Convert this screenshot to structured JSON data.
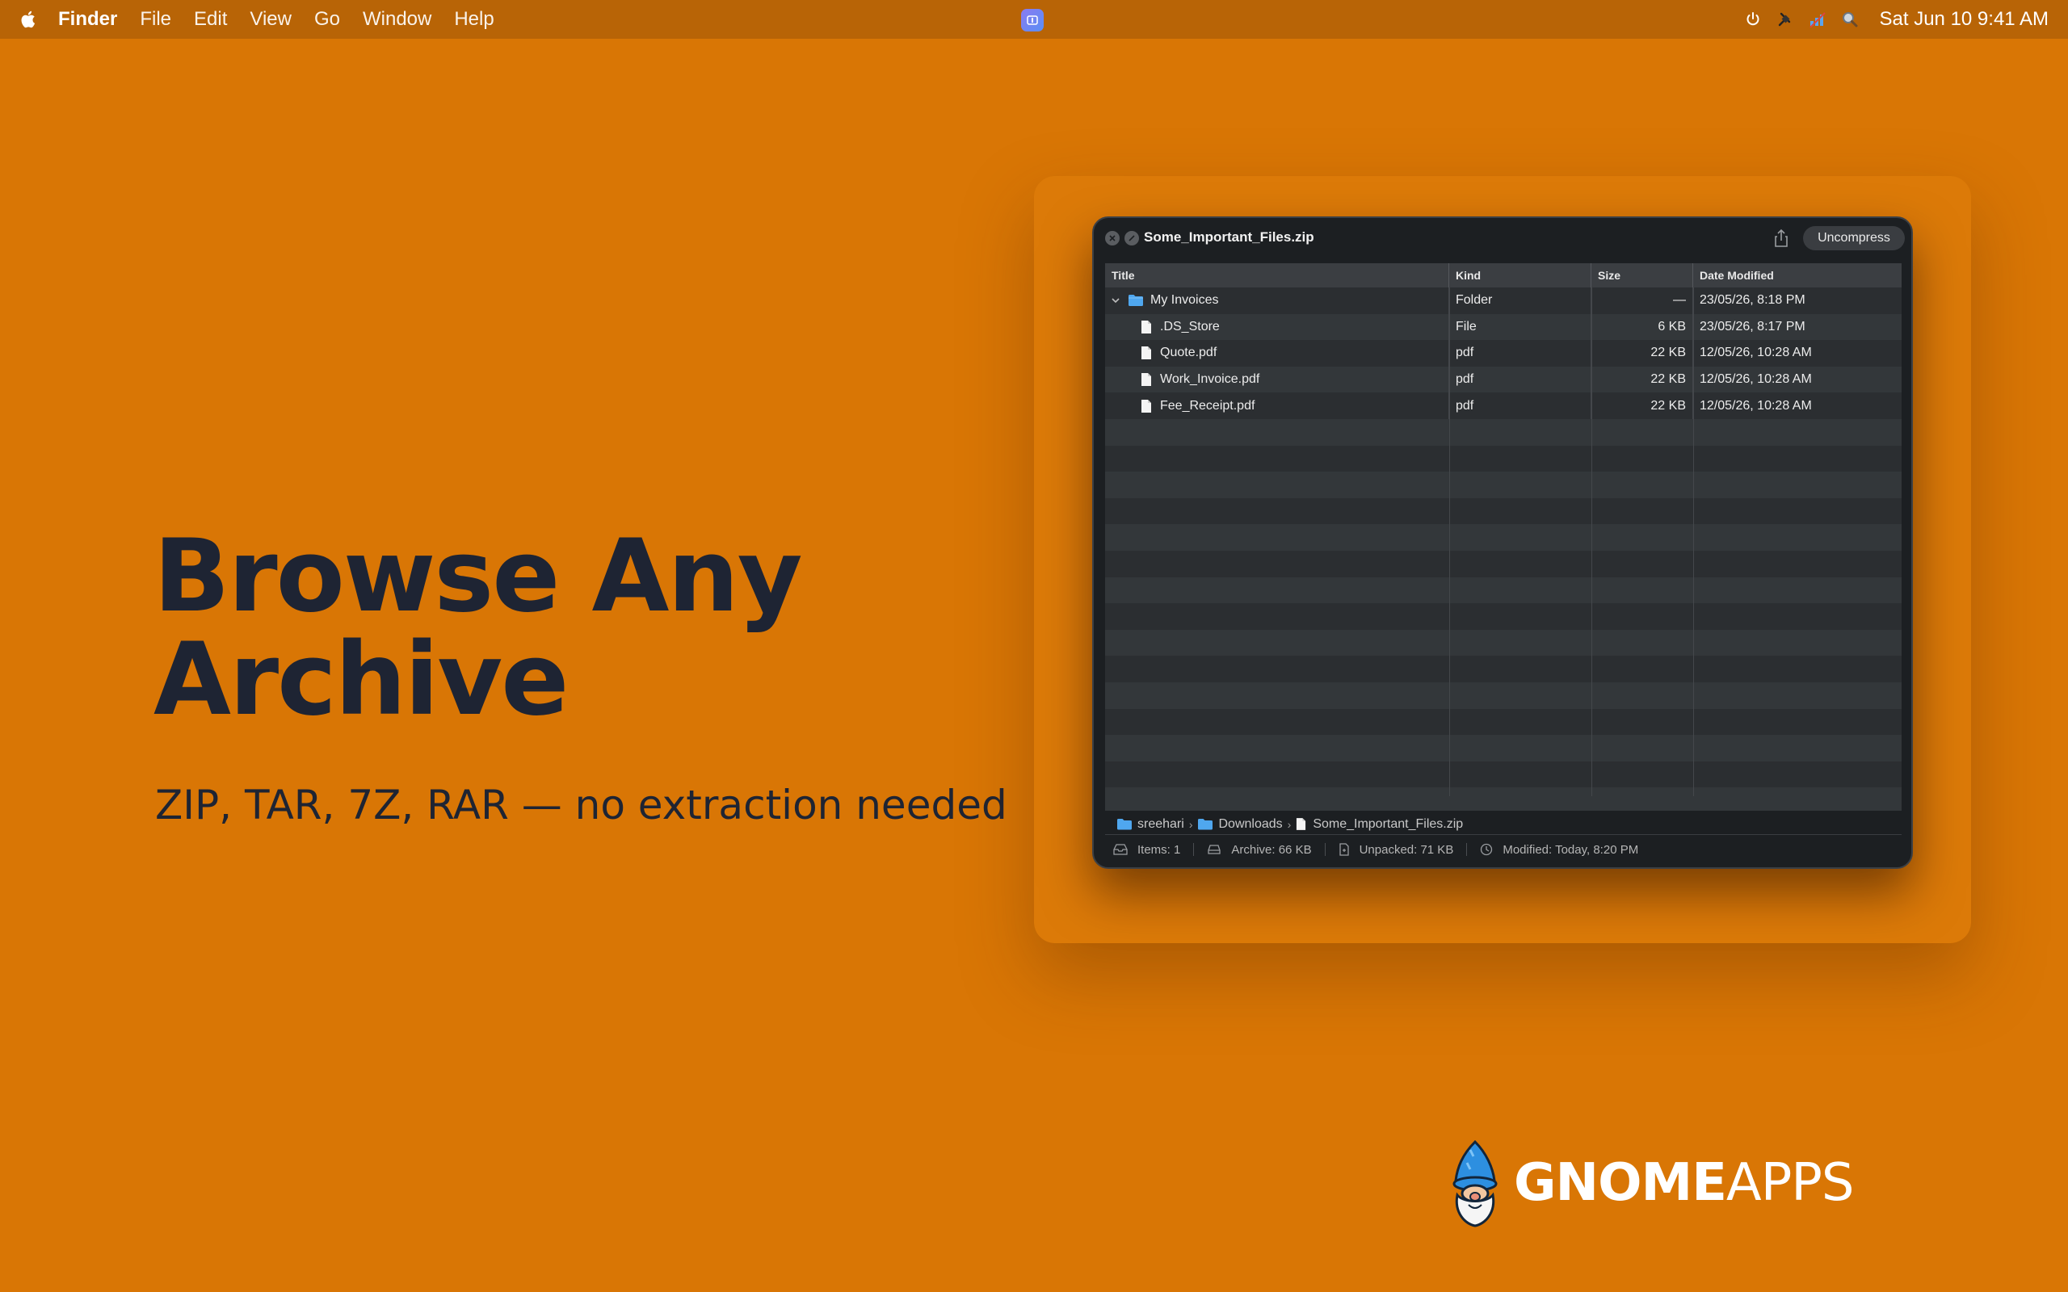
{
  "menubar": {
    "app_name": "Finder",
    "menus": [
      "File",
      "Edit",
      "View",
      "Go",
      "Window",
      "Help"
    ],
    "status_icons": [
      "power-icon",
      "plug-icon",
      "wifi-icon",
      "search-icon"
    ],
    "clock": "Sat Jun 10 9:41 AM"
  },
  "hero": {
    "title_line1": "Browse Any",
    "title_line2": "Archive",
    "subtitle": "ZIP, TAR, 7Z, RAR — no extraction needed"
  },
  "window": {
    "title": "Some_Important_Files.zip",
    "uncompress_label": "Uncompress",
    "columns": {
      "title": "Title",
      "kind": "Kind",
      "size": "Size",
      "date": "Date Modified"
    },
    "rows": [
      {
        "name": "My Invoices",
        "kind": "Folder",
        "size": "—",
        "date": "23/05/26, 8:18 PM",
        "icon": "folder-icon",
        "expanded": true
      },
      {
        "name": ".DS_Store",
        "kind": "File",
        "size": "6 KB",
        "date": "23/05/26, 8:17 PM",
        "icon": "file-icon"
      },
      {
        "name": "Quote.pdf",
        "kind": "pdf",
        "size": "22 KB",
        "date": "12/05/26, 10:28 AM",
        "icon": "file-icon"
      },
      {
        "name": "Work_Invoice.pdf",
        "kind": "pdf",
        "size": "22 KB",
        "date": "12/05/26, 10:28 AM",
        "icon": "file-icon"
      },
      {
        "name": "Fee_Receipt.pdf",
        "kind": "pdf",
        "size": "22 KB",
        "date": "12/05/26, 10:28 AM",
        "icon": "file-icon"
      }
    ],
    "path": [
      "sreehari",
      "Downloads",
      "Some_Important_Files.zip"
    ],
    "status": {
      "items": "Items: 1",
      "archive": "Archive: 66 KB",
      "unpacked": "Unpacked: 71 KB",
      "modified": "Modified: Today, 8:20 PM"
    }
  },
  "logo": {
    "bold": "GNOME",
    "light": "APPS"
  },
  "colors": {
    "background": "#d97605",
    "menubar": "#b86406",
    "headline": "#1e2433",
    "folder": "#4fa7ef"
  }
}
